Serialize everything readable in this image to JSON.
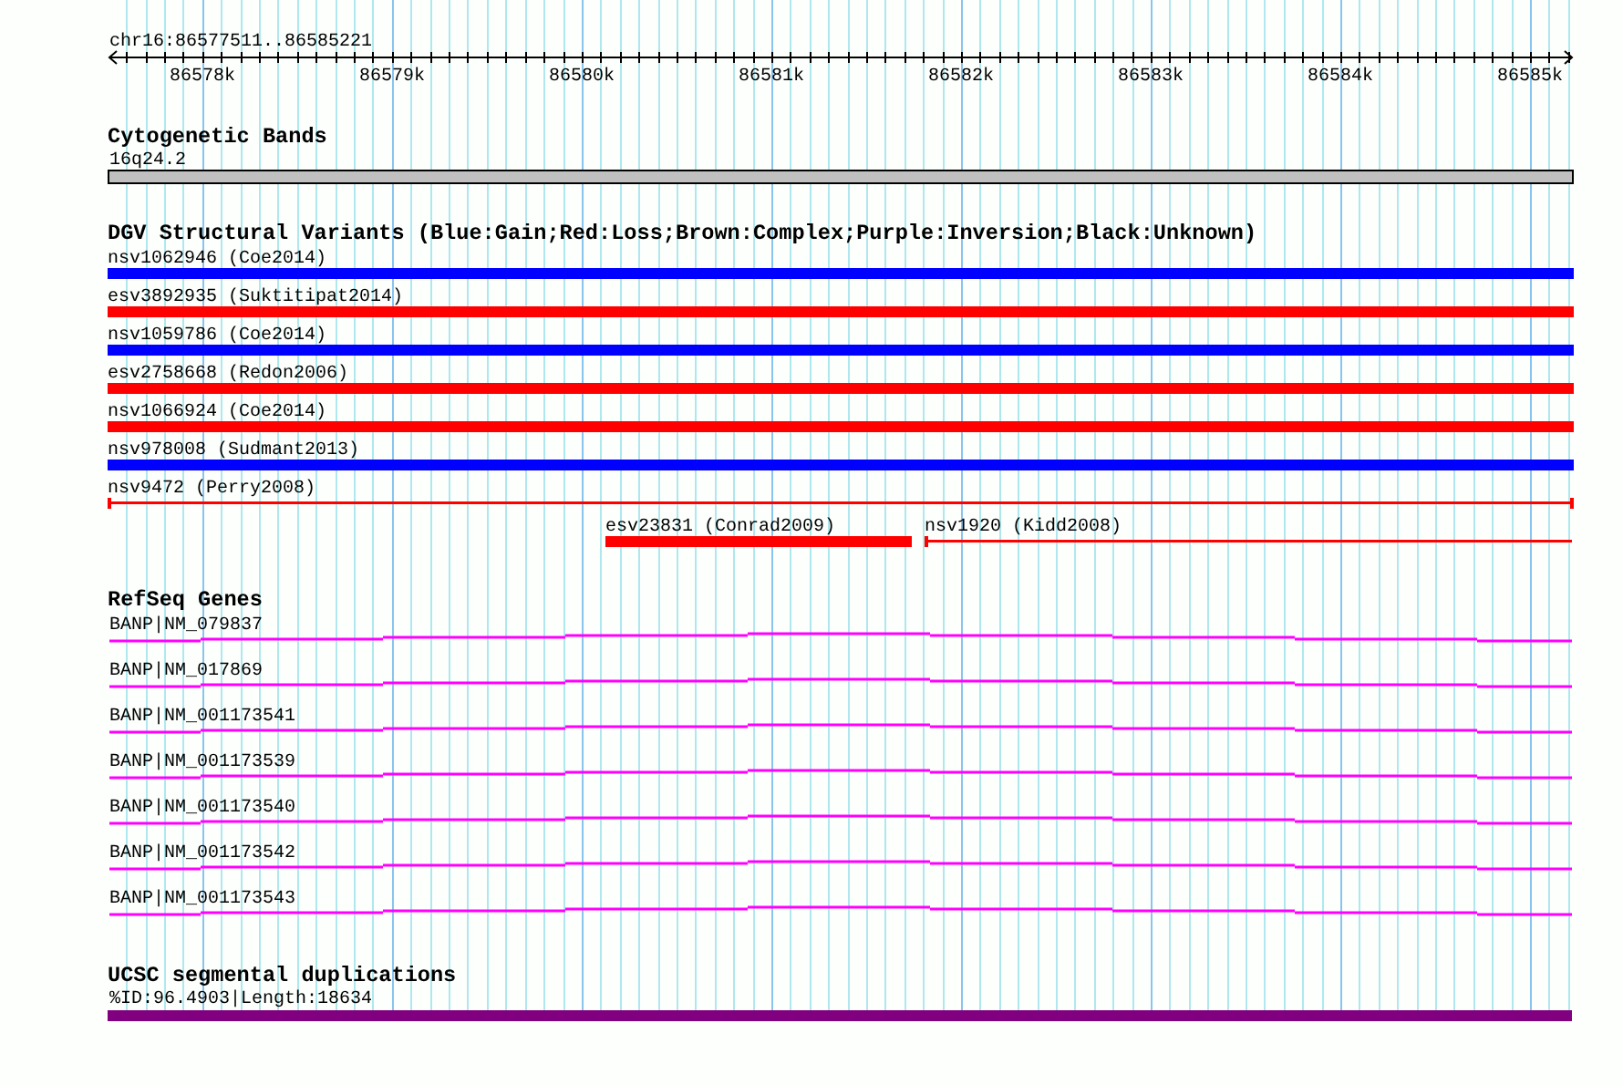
{
  "ruler": {
    "region": "chr16:86577511..86585221",
    "tick_labels": [
      "86578k",
      "86579k",
      "86580k",
      "86581k",
      "86582k",
      "86583k",
      "86584k",
      "86585k"
    ]
  },
  "tracks": [
    {
      "title": "Cytogenetic Bands",
      "features": [
        {
          "label": "16q24.2",
          "kind": "band"
        }
      ]
    },
    {
      "title": "DGV Structural Variants (Blue:Gain;Red:Loss;Brown:Complex;Purple:Inversion;Black:Unknown)",
      "features": [
        {
          "label": "nsv1062946 (Coe2014)",
          "kind": "bar",
          "color": "#0000ff"
        },
        {
          "label": "esv3892935 (Suktitipat2014)",
          "kind": "bar",
          "color": "#ff0000"
        },
        {
          "label": "nsv1059786 (Coe2014)",
          "kind": "bar",
          "color": "#0000ff"
        },
        {
          "label": "esv2758668 (Redon2006)",
          "kind": "bar",
          "color": "#ff0000"
        },
        {
          "label": "nsv1066924 (Coe2014)",
          "kind": "bar",
          "color": "#ff0000"
        },
        {
          "label": "nsv978008 (Sudmant2013)",
          "kind": "bar",
          "color": "#0000ff"
        },
        {
          "label": "nsv9472 (Perry2008)",
          "kind": "line",
          "color": "#ff0000"
        },
        {
          "label": "esv23831 (Conrad2009)",
          "kind": "bar",
          "color": "#ff0000"
        },
        {
          "label": "nsv1920 (Kidd2008)",
          "kind": "line",
          "color": "#ff0000"
        }
      ]
    },
    {
      "title": "RefSeq Genes",
      "features": [
        {
          "label": "BANP|NM_079837",
          "kind": "gene"
        },
        {
          "label": "BANP|NM_017869",
          "kind": "gene"
        },
        {
          "label": "BANP|NM_001173541",
          "kind": "gene"
        },
        {
          "label": "BANP|NM_001173539",
          "kind": "gene"
        },
        {
          "label": "BANP|NM_001173540",
          "kind": "gene"
        },
        {
          "label": "BANP|NM_001173542",
          "kind": "gene"
        },
        {
          "label": "BANP|NM_001173543",
          "kind": "gene"
        }
      ]
    },
    {
      "title": "UCSC segmental duplications",
      "features": [
        {
          "label": "%ID:96.4903|Length:18634",
          "kind": "duplication"
        }
      ]
    }
  ]
}
